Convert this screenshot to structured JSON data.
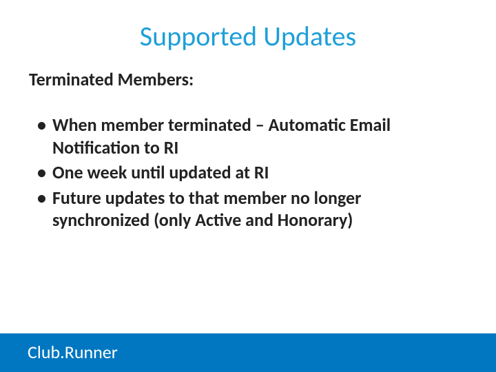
{
  "title": "Supported Updates",
  "subtitle": "Terminated Members:",
  "bullets": [
    "When member terminated – Automatic Email Notification to RI",
    "One week until updated at RI",
    "Future updates to that member no longer synchronized (only Active and Honorary)"
  ],
  "footer": {
    "brand": "Club.Runner"
  }
}
